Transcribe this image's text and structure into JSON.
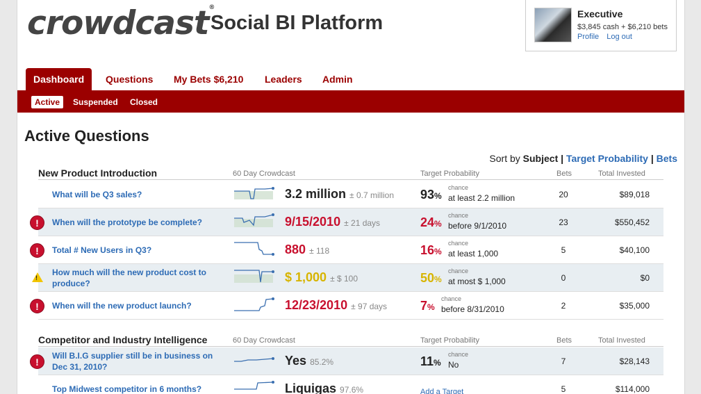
{
  "logo": {
    "text": "crowdcast",
    "tm": "®"
  },
  "platform_title": "Social BI Platform",
  "user": {
    "name": "Executive",
    "cash": "$3,845 cash + $6,210 bets",
    "profile_link": "Profile",
    "logout_link": "Log out"
  },
  "nav": {
    "tabs": [
      {
        "label": "Dashboard"
      },
      {
        "label": "Questions"
      },
      {
        "label": "My Bets $6,210"
      },
      {
        "label": "Leaders"
      },
      {
        "label": "Admin"
      }
    ]
  },
  "subnav": {
    "items": [
      {
        "label": "Active"
      },
      {
        "label": "Suspended"
      },
      {
        "label": "Closed"
      }
    ]
  },
  "page_heading": "Active Questions",
  "sort": {
    "prefix": "Sort by",
    "subject": "Subject",
    "sep": "|",
    "target_probability": "Target Probability",
    "bets": "Bets"
  },
  "columns": {
    "crowdcast": "60 Day Crowdcast",
    "target_probability": "Target Probability",
    "bets": "Bets",
    "total_invested": "Total Invested"
  },
  "chance_label": "chance",
  "sections": [
    {
      "name": "New Product Introduction",
      "rows": [
        {
          "question": "What will be Q3 sales?",
          "alert": "none",
          "value": "3.2 million",
          "margin": "± 0.7 million",
          "value_color": "dark",
          "prob": "93",
          "pct": "%",
          "target": "at least 2.2 million",
          "bets": "20",
          "invested": "$89,018"
        },
        {
          "question": "When will the prototype be complete?",
          "alert": "red",
          "value": "9/15/2010",
          "margin": "± 21 days",
          "value_color": "red",
          "prob": "24",
          "pct": "%",
          "target": "before 9/1/2010",
          "bets": "23",
          "invested": "$550,452"
        },
        {
          "question": "Total # New Users in Q3?",
          "alert": "red",
          "value": "880",
          "margin": "± 118",
          "value_color": "red",
          "prob": "16",
          "pct": "%",
          "target": "at least 1,000",
          "bets": "5",
          "invested": "$40,100"
        },
        {
          "question": "How much will the new product cost to produce?",
          "alert": "yellow",
          "value": "$ 1,000",
          "margin": "± $ 100",
          "value_color": "yellow",
          "prob": "50",
          "pct": "%",
          "target": "at most $ 1,000",
          "bets": "0",
          "invested": "$0"
        },
        {
          "question": "When will the new product launch?",
          "alert": "red",
          "value": "12/23/2010",
          "margin": "± 97 days",
          "value_color": "red",
          "prob": "7",
          "pct": "%",
          "target": "before 8/31/2010",
          "bets": "2",
          "invested": "$35,000"
        }
      ]
    },
    {
      "name": "Competitor and Industry Intelligence",
      "rows": [
        {
          "question": "Will B.I.G supplier still be in business on Dec 31, 2010?",
          "alert": "red",
          "value": "Yes",
          "margin": "85.2%",
          "value_color": "dark",
          "prob": "11",
          "pct": "%",
          "target": "No",
          "bets": "7",
          "invested": "$28,143"
        },
        {
          "question": "Top Midwest competitor in 6 months?",
          "alert": "none",
          "value": "Liquigas",
          "margin": "97.6%",
          "value_color": "dark",
          "add_target": "Add a Target",
          "bets": "5",
          "invested": "$114,000"
        }
      ]
    }
  ],
  "colors": {
    "brand_red": "#9b0000",
    "alert_red": "#c8102e",
    "warn_yellow": "#d7b400",
    "link_blue": "#2d6bb5"
  },
  "icons": {
    "alert": "exclamation-circle-icon",
    "warning": "warning-triangle-icon"
  }
}
